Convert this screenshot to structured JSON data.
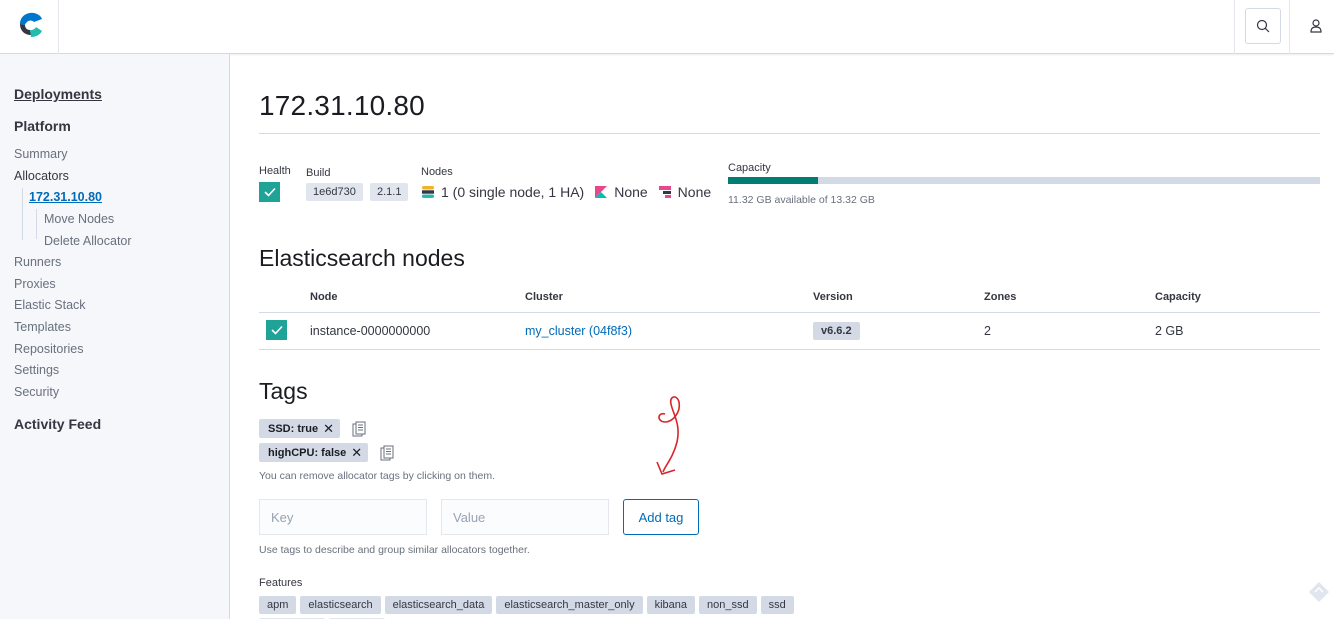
{
  "header": {
    "logo_icon": "elastic-cloud-logo",
    "search_icon": "search-icon",
    "user_icon": "user-icon"
  },
  "sidebar": {
    "deployments": "Deployments",
    "platform": "Platform",
    "items": [
      {
        "label": "Summary"
      },
      {
        "label": "Allocators"
      },
      {
        "label": "172.31.10.80"
      },
      {
        "label": "Move Nodes"
      },
      {
        "label": "Delete Allocator"
      },
      {
        "label": "Runners"
      },
      {
        "label": "Proxies"
      },
      {
        "label": "Elastic Stack"
      },
      {
        "label": "Templates"
      },
      {
        "label": "Repositories"
      },
      {
        "label": "Settings"
      },
      {
        "label": "Security"
      }
    ],
    "activity_feed": "Activity Feed"
  },
  "page": {
    "title": "172.31.10.80"
  },
  "stats": {
    "health_label": "Health",
    "build_label": "Build",
    "build_hash": "1e6d730",
    "build_version": "2.1.1",
    "nodes_label": "Nodes",
    "nodes_es": "1 (0 single node, 1 HA)",
    "nodes_kibana": "None",
    "nodes_apm": "None",
    "capacity_label": "Capacity",
    "capacity_fraction": 0.152,
    "capacity_note": "11.32 GB available of 13.32 GB"
  },
  "es_nodes": {
    "heading": "Elasticsearch nodes",
    "columns": [
      "Node",
      "Cluster",
      "Version",
      "Zones",
      "Capacity"
    ],
    "rows": [
      {
        "node": "instance-0000000000",
        "cluster": "my_cluster (04f8f3)",
        "version": "v6.6.2",
        "zones": "2",
        "capacity": "2 GB"
      }
    ]
  },
  "tags": {
    "heading": "Tags",
    "items": [
      {
        "label": "SSD: true"
      },
      {
        "label": "highCPU: false"
      }
    ],
    "remove_help": "You can remove allocator tags by clicking on them.",
    "key_placeholder": "Key",
    "value_placeholder": "Value",
    "add_button": "Add tag",
    "usage_help": "Use tags to describe and group similar allocators together."
  },
  "features": {
    "label": "Features",
    "items": [
      "apm",
      "elasticsearch",
      "elasticsearch_data",
      "elasticsearch_master_only",
      "kibana",
      "non_ssd",
      "ssd"
    ]
  },
  "colors": {
    "accent": "#006bb8",
    "health": "#1fa396",
    "capacity_fill": "#017d73",
    "annotation": "#d8262a"
  }
}
